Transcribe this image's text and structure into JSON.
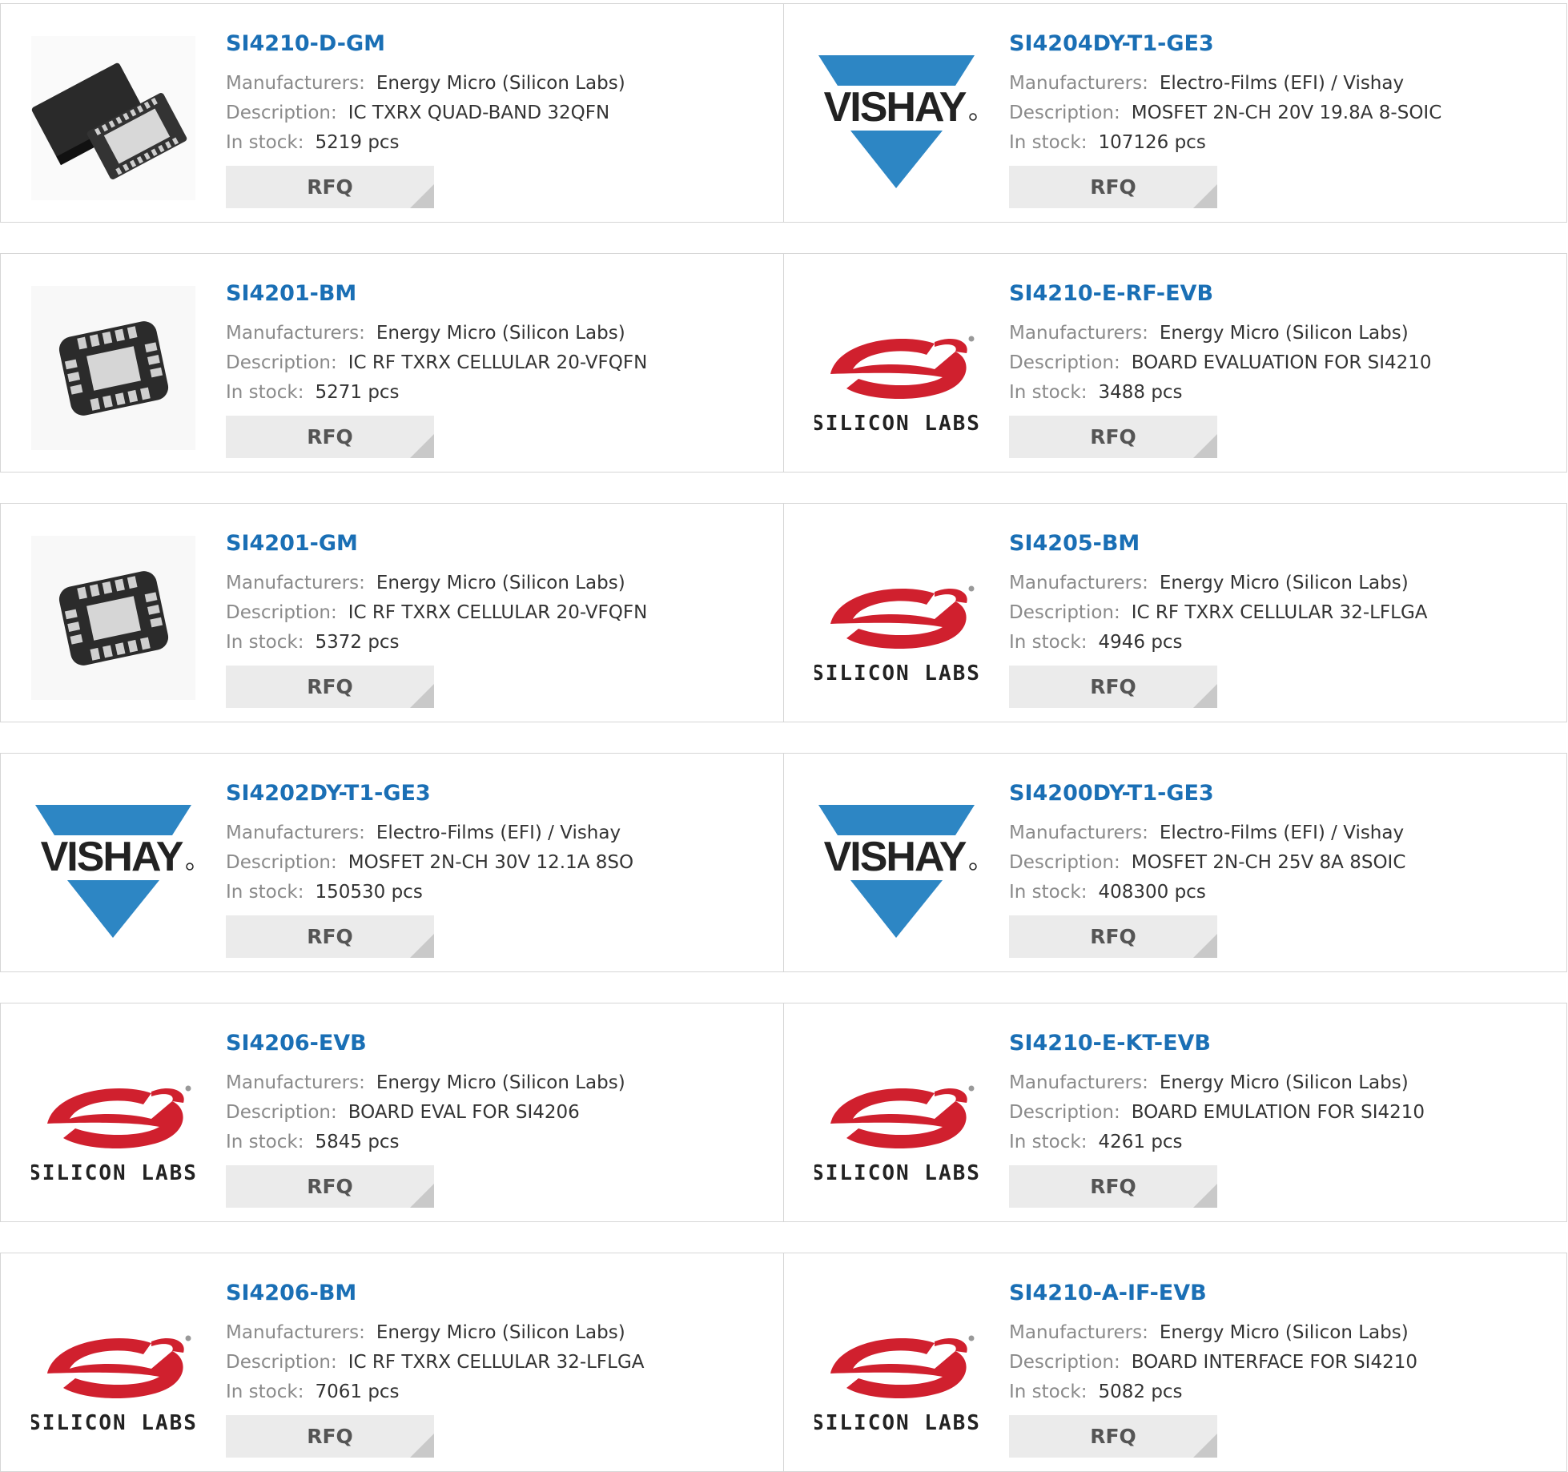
{
  "labels": {
    "manufacturer": "Manufacturers:",
    "description": "Description:",
    "stock": "In stock:"
  },
  "rfq_label": "RFQ",
  "logo_text": {
    "vishay": "VISHAY",
    "silicon_labs": "SILICON LABS"
  },
  "colors": {
    "link": "#1a6fb5",
    "vishay": "#2d86c4",
    "silabs": "#d0202e"
  },
  "products": [
    {
      "part": "SI4210-D-GM",
      "manufacturer": "Energy Micro (Silicon Labs)",
      "description": "IC TXRX QUAD-BAND 32QFN",
      "stock": "5219 pcs",
      "image": "chip-qfn32"
    },
    {
      "part": "SI4204DY-T1-GE3",
      "manufacturer": "Electro-Films (EFI) / Vishay",
      "description": "MOSFET 2N-CH 20V 19.8A 8-SOIC",
      "stock": "107126 pcs",
      "image": "vishay-logo"
    },
    {
      "part": "SI4201-BM",
      "manufacturer": "Energy Micro (Silicon Labs)",
      "description": "IC RF TXRX CELLULAR 20-VFQFN",
      "stock": "5271 pcs",
      "image": "chip-qfn20"
    },
    {
      "part": "SI4210-E-RF-EVB",
      "manufacturer": "Energy Micro (Silicon Labs)",
      "description": "BOARD EVALUATION FOR SI4210",
      "stock": "3488 pcs",
      "image": "silicon-labs-logo"
    },
    {
      "part": "SI4201-GM",
      "manufacturer": "Energy Micro (Silicon Labs)",
      "description": "IC RF TXRX CELLULAR 20-VFQFN",
      "stock": "5372 pcs",
      "image": "chip-qfn20"
    },
    {
      "part": "SI4205-BM",
      "manufacturer": "Energy Micro (Silicon Labs)",
      "description": "IC RF TXRX CELLULAR 32-LFLGA",
      "stock": "4946 pcs",
      "image": "silicon-labs-logo"
    },
    {
      "part": "SI4202DY-T1-GE3",
      "manufacturer": "Electro-Films (EFI) / Vishay",
      "description": "MOSFET 2N-CH 30V 12.1A 8SO",
      "stock": "150530 pcs",
      "image": "vishay-logo"
    },
    {
      "part": "SI4200DY-T1-GE3",
      "manufacturer": "Electro-Films (EFI) / Vishay",
      "description": "MOSFET 2N-CH 25V 8A 8SOIC",
      "stock": "408300 pcs",
      "image": "vishay-logo"
    },
    {
      "part": "SI4206-EVB",
      "manufacturer": "Energy Micro (Silicon Labs)",
      "description": "BOARD EVAL FOR SI4206",
      "stock": "5845 pcs",
      "image": "silicon-labs-logo"
    },
    {
      "part": "SI4210-E-KT-EVB",
      "manufacturer": "Energy Micro (Silicon Labs)",
      "description": "BOARD EMULATION FOR SI4210",
      "stock": "4261 pcs",
      "image": "silicon-labs-logo"
    },
    {
      "part": "SI4206-BM",
      "manufacturer": "Energy Micro (Silicon Labs)",
      "description": "IC RF TXRX CELLULAR 32-LFLGA",
      "stock": "7061 pcs",
      "image": "silicon-labs-logo"
    },
    {
      "part": "SI4210-A-IF-EVB",
      "manufacturer": "Energy Micro (Silicon Labs)",
      "description": "BOARD INTERFACE FOR SI4210",
      "stock": "5082 pcs",
      "image": "silicon-labs-logo"
    }
  ]
}
